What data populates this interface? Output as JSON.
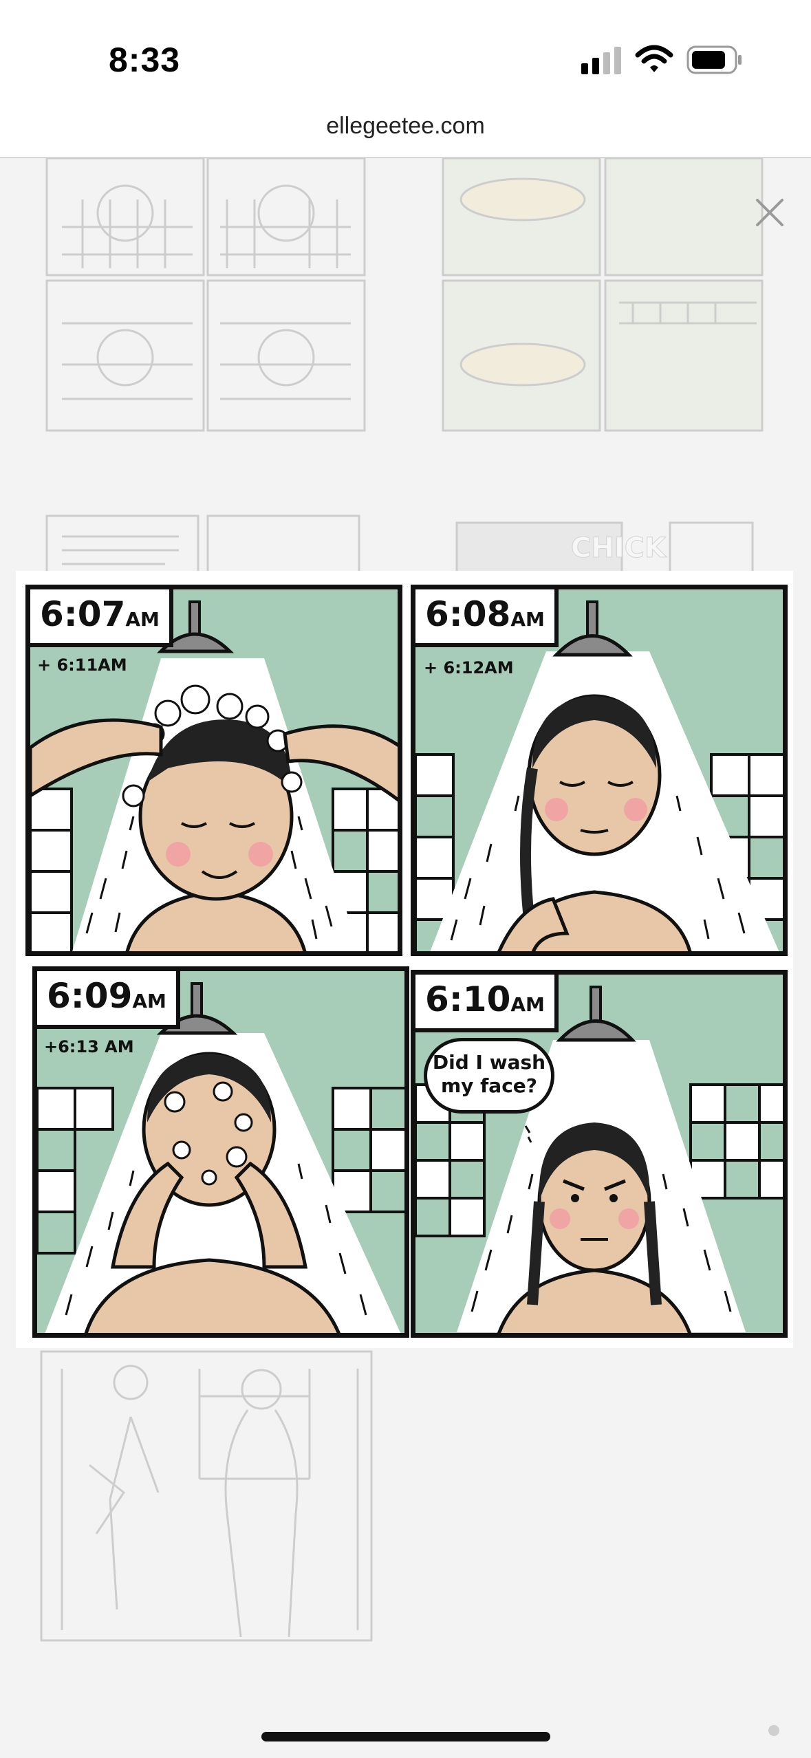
{
  "status_bar": {
    "time": "8:33",
    "signal_icon": "cellular-signal-icon",
    "wifi_icon": "wifi-icon",
    "battery_icon": "battery-icon"
  },
  "browser": {
    "url": "ellegeetee.com"
  },
  "lightbox": {
    "close_icon": "close-icon"
  },
  "comic": {
    "panels": [
      {
        "time": "6:07",
        "ampm": "AM",
        "note": "+ 6:11AM"
      },
      {
        "time": "6:08",
        "ampm": "AM",
        "note": "+ 6:12AM"
      },
      {
        "time": "6:09",
        "ampm": "AM",
        "note": "+6:13 AM"
      },
      {
        "time": "6:10",
        "ampm": "AM",
        "note": "",
        "speech_line1": "Did I wash",
        "speech_line2": "my face?"
      }
    ]
  },
  "background_tiles": {
    "chick_label": "CHICK"
  },
  "colors": {
    "panel_bg": "#a7cdb8",
    "skin": "#e8c7a8",
    "blush": "#f0a4a4",
    "tile_green": "#a7cdb8"
  }
}
